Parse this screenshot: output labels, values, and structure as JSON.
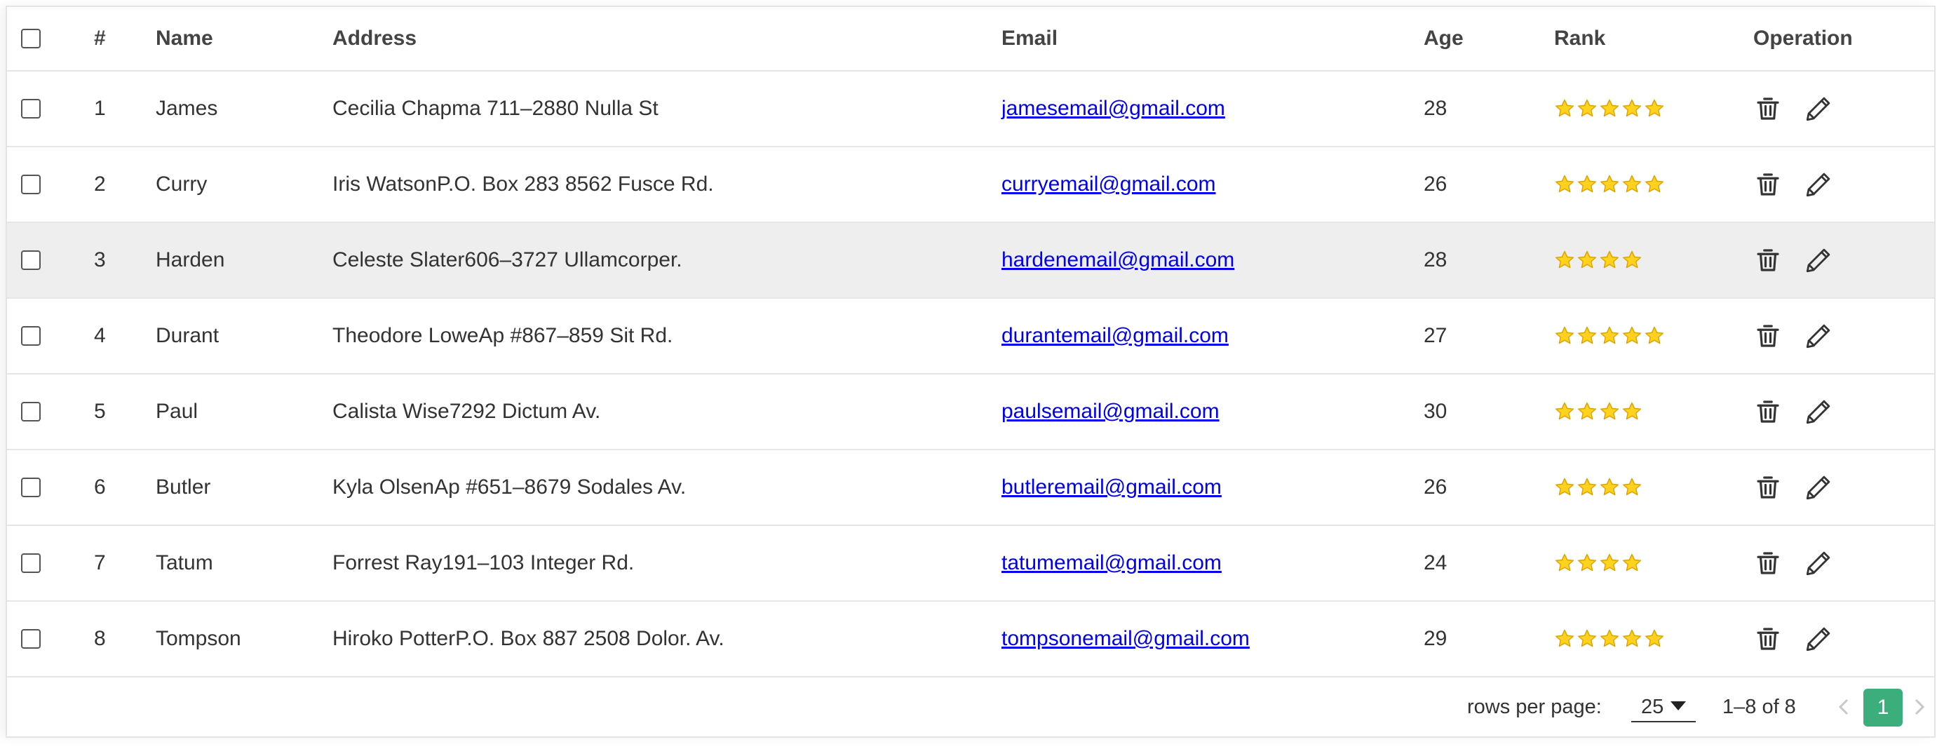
{
  "table": {
    "columns": [
      "#",
      "Name",
      "Address",
      "Email",
      "Age",
      "Rank",
      "Operation"
    ],
    "rows": [
      {
        "num": "1",
        "name": "James",
        "address": "Cecilia Chapma 711–2880 Nulla St",
        "email": "jamesemail@gmail.com",
        "age": "28",
        "rank": 5
      },
      {
        "num": "2",
        "name": "Curry",
        "address": "Iris WatsonP.O. Box 283 8562 Fusce Rd.",
        "email": "curryemail@gmail.com",
        "age": "26",
        "rank": 5
      },
      {
        "num": "3",
        "name": "Harden",
        "address": "Celeste Slater606–3727 Ullamcorper.",
        "email": "hardenemail@gmail.com",
        "age": "28",
        "rank": 4
      },
      {
        "num": "4",
        "name": "Durant",
        "address": "Theodore LoweAp #867–859 Sit Rd.",
        "email": "durantemail@gmail.com",
        "age": "27",
        "rank": 5
      },
      {
        "num": "5",
        "name": "Paul",
        "address": "Calista Wise7292 Dictum Av.",
        "email": "paulsemail@gmail.com",
        "age": "30",
        "rank": 4
      },
      {
        "num": "6",
        "name": "Butler",
        "address": "Kyla OlsenAp #651–8679 Sodales Av.",
        "email": "butleremail@gmail.com",
        "age": "26",
        "rank": 4
      },
      {
        "num": "7",
        "name": "Tatum",
        "address": "Forrest Ray191–103 Integer Rd.",
        "email": "tatumemail@gmail.com",
        "age": "24",
        "rank": 4
      },
      {
        "num": "8",
        "name": "Tompson",
        "address": "Hiroko PotterP.O. Box 887 2508 Dolor. Av.",
        "email": "tompsonemail@gmail.com",
        "age": "29",
        "rank": 5
      }
    ],
    "highlighted_row": 2,
    "icons": {
      "delete": "trash-icon",
      "edit": "pencil-icon",
      "rank": "star-icon"
    }
  },
  "footer": {
    "rows_per_page_label": "rows per page:",
    "rows_per_page_value": "25",
    "range_text": "1–8 of 8",
    "current_page": "1"
  },
  "colors": {
    "link": "#0000ee",
    "page_active": "#3cae7b",
    "star_fill": "#ffd21e",
    "star_stroke": "#e0a400",
    "row_highlight": "#eeeeee"
  }
}
